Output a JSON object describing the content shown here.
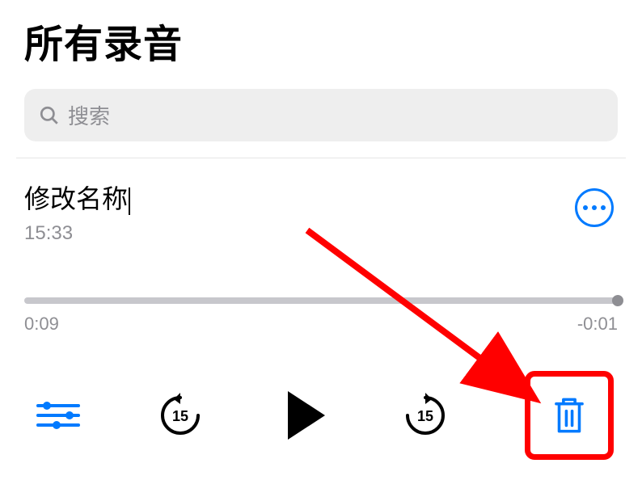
{
  "header": {
    "title": "所有录音"
  },
  "search": {
    "placeholder": "搜索"
  },
  "recording": {
    "title": "修改名称",
    "timestamp": "15:33",
    "elapsed": "0:09",
    "remaining": "-0:01",
    "skip_seconds": "15"
  },
  "colors": {
    "accent": "#007aff",
    "highlight": "#ff0000"
  }
}
